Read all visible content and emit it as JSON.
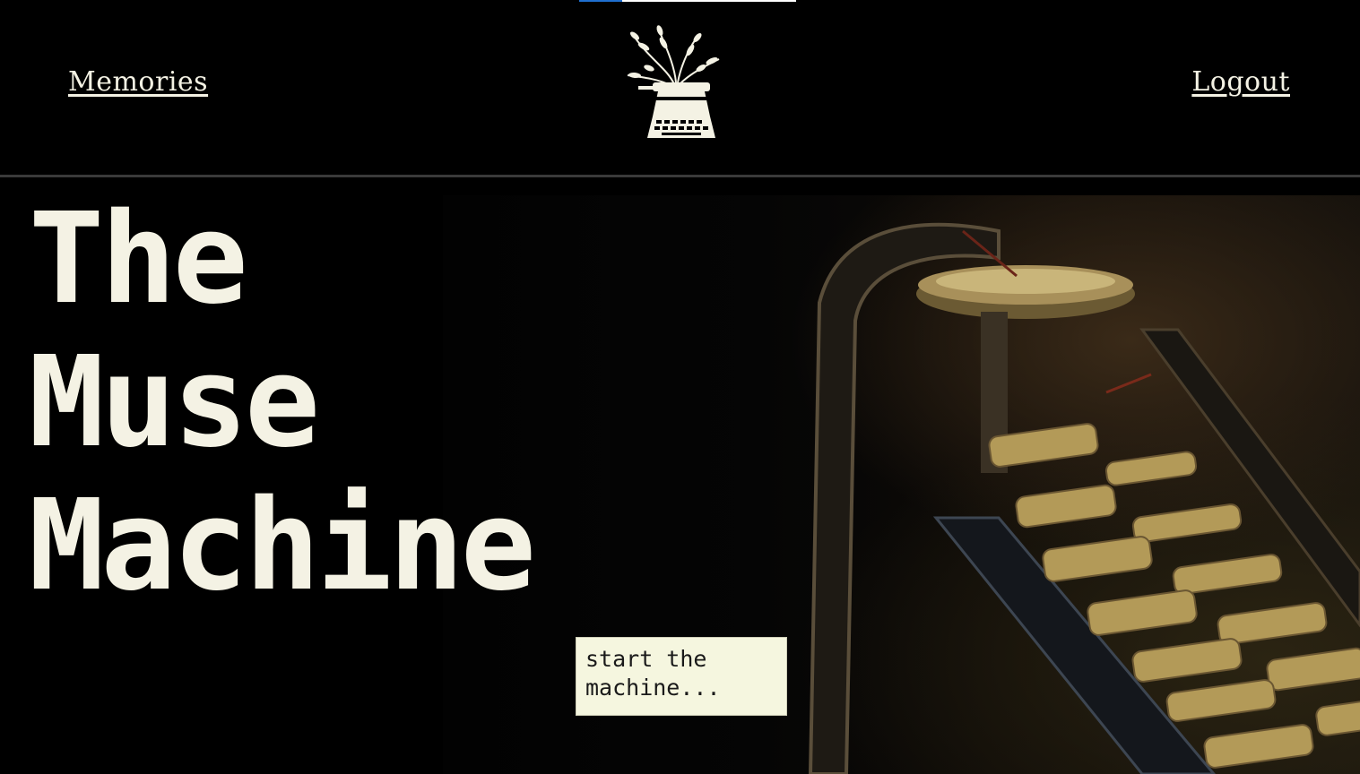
{
  "nav": {
    "memories_label": "Memories",
    "logout_label": "Logout",
    "logo_icon": "typewriter-plant-icon"
  },
  "hero": {
    "title": "The\nMuse\nMachine",
    "cta_label": "start the\nmachine..."
  },
  "colors": {
    "background": "#000000",
    "text_light": "#f4f2e4",
    "cta_background": "#f5f6df",
    "accent_blue": "#1f6fd0"
  }
}
